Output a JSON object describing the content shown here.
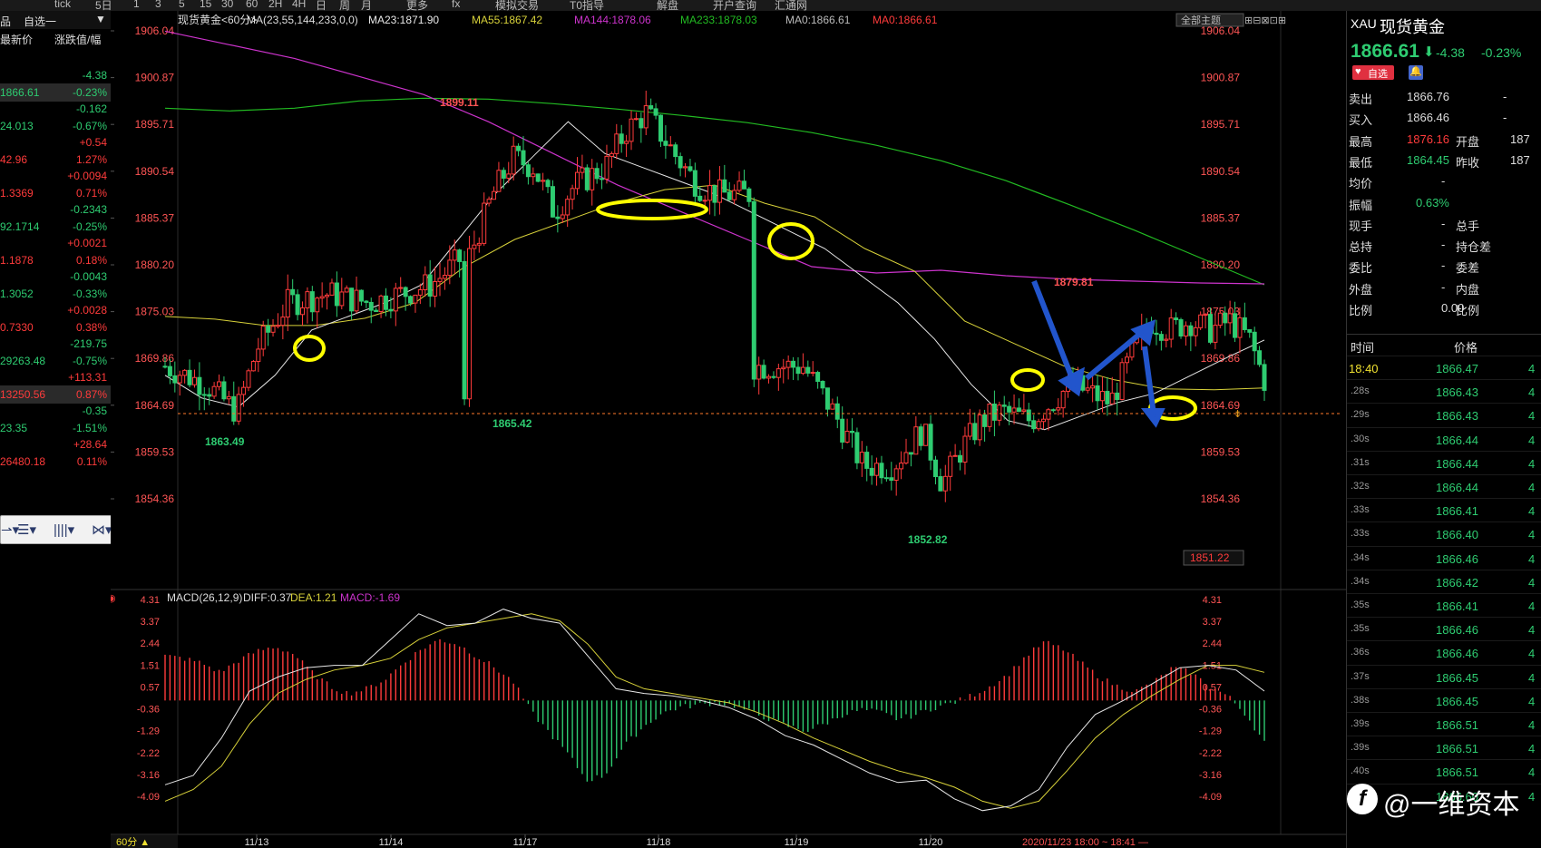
{
  "toolbar": {
    "items": [
      "tick",
      "5日",
      "1",
      "3",
      "5",
      "15",
      "30",
      "60",
      "2H",
      "4H",
      "日",
      "周",
      "月",
      "更多",
      "fx",
      "模拟交易",
      "T0指导",
      "解盘",
      "开户查询",
      "汇通网"
    ]
  },
  "watchlist": {
    "header_tab": "自选一",
    "col1": "最新价",
    "col2": "涨跌值/幅",
    "rows": [
      {
        "price": "",
        "chg": "-4.38",
        "color": "green"
      },
      {
        "price": "1866.61",
        "chg": "-0.23%",
        "color": "green"
      },
      {
        "price": "",
        "chg": "-0.162",
        "color": "green"
      },
      {
        "price": "24.013",
        "chg": "-0.67%",
        "color": "green"
      },
      {
        "price": "",
        "chg": "+0.54",
        "color": "red"
      },
      {
        "price": "42.96",
        "chg": "1.27%",
        "color": "red"
      },
      {
        "price": "",
        "chg": "+0.0094",
        "color": "red"
      },
      {
        "price": "1.3369",
        "chg": "0.71%",
        "color": "red"
      },
      {
        "price": "",
        "chg": "-0.2343",
        "color": "green"
      },
      {
        "price": "92.1714",
        "chg": "-0.25%",
        "color": "green"
      },
      {
        "price": "",
        "chg": "+0.0021",
        "color": "red"
      },
      {
        "price": "1.1878",
        "chg": "0.18%",
        "color": "red"
      },
      {
        "price": "",
        "chg": "-0.0043",
        "color": "green"
      },
      {
        "price": "1.3052",
        "chg": "-0.33%",
        "color": "green"
      },
      {
        "price": "",
        "chg": "+0.0028",
        "color": "red"
      },
      {
        "price": "0.7330",
        "chg": "0.38%",
        "color": "red"
      },
      {
        "price": "",
        "chg": "-219.75",
        "color": "green"
      },
      {
        "price": "29263.48",
        "chg": "-0.75%",
        "color": "green"
      },
      {
        "price": "",
        "chg": "+113.31",
        "color": "red"
      },
      {
        "price": "13250.56",
        "chg": "0.87%",
        "color": "red"
      },
      {
        "price": "",
        "chg": "-0.35",
        "color": "green"
      },
      {
        "price": "23.35",
        "chg": "-1.51%",
        "color": "green"
      },
      {
        "price": "",
        "chg": "+28.64",
        "color": "red"
      },
      {
        "price": "26480.18",
        "chg": "0.11%",
        "color": "red"
      }
    ]
  },
  "chart": {
    "title": "现货黄金<60分>",
    "ma_params": "MA(23,55,144,233,0,0)",
    "ma23": "MA23:1871.90",
    "ma55": "MA55:1867.42",
    "ma144": "MA144:1878.06",
    "ma233": "MA233:1878.03",
    "ma0a": "MA0:1866.61",
    "ma0b": "MA0:1866.61",
    "theme_button": "全部主题",
    "price_labels": [
      "1906.04",
      "1900.87",
      "1895.71",
      "1890.54",
      "1885.37",
      "1880.20",
      "1875.03",
      "1869.86",
      "1864.69",
      "1859.53",
      "1854.36"
    ],
    "current_tag": "1851.22",
    "annotations": {
      "high1": "1899.11",
      "low1": "1863.49",
      "low2": "1865.42",
      "low3": "1852.82",
      "high2": "1879.81"
    },
    "macd_title": "MACD(26,12,9)",
    "diff": "DIFF:0.37",
    "dea": "DEA:1.21",
    "macd": "MACD:-1.69",
    "macd_labels": [
      "4.31",
      "3.37",
      "2.44",
      "1.51",
      "0.57",
      "-0.36",
      "-1.29",
      "-2.22",
      "-3.16",
      "-4.09"
    ],
    "dates": [
      "11/13",
      "11/14",
      "11/17",
      "11/18",
      "11/19",
      "11/20"
    ],
    "period_label": "60分 ▲",
    "time_range": "2020/11/23 18:00 ~ 18:41 —",
    "colors": {
      "up": "#ff3b3b",
      "down": "#2ecc71",
      "ma23": "#e8e8e8",
      "ma55": "#d8d23a",
      "ma144": "#cc33cc",
      "ma233": "#22bb22",
      "highlight": "#ffff00",
      "arrow": "#2255cc"
    }
  },
  "chart_data": {
    "type": "candlestick",
    "title": "现货黄金<60分>",
    "x_dates": [
      "11/13",
      "11/14",
      "11/17",
      "11/18",
      "11/19",
      "11/20"
    ],
    "ylim": [
      1851.22,
      1906.04
    ],
    "last_price": 1866.61,
    "marked_highs": [
      1899.11,
      1879.81
    ],
    "marked_lows": [
      1863.49,
      1865.42,
      1852.82
    ],
    "macd": {
      "diff": 0.37,
      "dea": 1.21,
      "macd": -1.69,
      "ylim": [
        -4.09,
        4.31
      ]
    }
  },
  "quote": {
    "code": "XAU",
    "name": "现货黄金",
    "price": "1866.61",
    "change": "-4.38",
    "change_pct": "-0.23%",
    "fav_button": "自选",
    "rows": [
      {
        "l": "卖出",
        "v": "1866.76",
        "l2": "",
        "v2": "-"
      },
      {
        "l": "买入",
        "v": "1866.46",
        "l2": "",
        "v2": "-"
      },
      {
        "l": "最高",
        "v": "1876.16",
        "l2": "开盘",
        "v2": "187"
      },
      {
        "l": "最低",
        "v": "1864.45",
        "l2": "昨收",
        "v2": "187"
      },
      {
        "l": "均价",
        "v": "-",
        "l2": "",
        "v2": ""
      },
      {
        "l": "振幅",
        "v": "0.63%",
        "l2": "",
        "v2": ""
      },
      {
        "l": "现手",
        "v": "-",
        "l2": "总手",
        "v2": ""
      },
      {
        "l": "总持",
        "v": "-",
        "l2": "持仓差",
        "v2": ""
      },
      {
        "l": "委比",
        "v": "-",
        "l2": "委差",
        "v2": ""
      },
      {
        "l": "外盘",
        "v": "-",
        "l2": "内盘",
        "v2": ""
      },
      {
        "l": "比例",
        "v": "0.00",
        "l2": "比例",
        "v2": ""
      }
    ],
    "tick_header_time": "时间",
    "tick_header_price": "价格",
    "ticks": [
      {
        "t": "18:40",
        "p": "1866.47"
      },
      {
        "t": ".28s",
        "p": "1866.43"
      },
      {
        "t": ".29s",
        "p": "1866.43"
      },
      {
        "t": ".30s",
        "p": "1866.44"
      },
      {
        "t": ".31s",
        "p": "1866.44"
      },
      {
        "t": ".32s",
        "p": "1866.44"
      },
      {
        "t": ".33s",
        "p": "1866.41"
      },
      {
        "t": ".33s",
        "p": "1866.40"
      },
      {
        "t": ".34s",
        "p": "1866.46"
      },
      {
        "t": ".34s",
        "p": "1866.42"
      },
      {
        "t": ".35s",
        "p": "1866.41"
      },
      {
        "t": ".35s",
        "p": "1866.46"
      },
      {
        "t": ".36s",
        "p": "1866.46"
      },
      {
        "t": ".37s",
        "p": "1866.45"
      },
      {
        "t": ".38s",
        "p": "1866.45"
      },
      {
        "t": ".39s",
        "p": "1866.51"
      },
      {
        "t": ".39s",
        "p": "1866.51"
      },
      {
        "t": ".40s",
        "p": "1866.51"
      },
      {
        "t": ".40s",
        "p": "1866.60"
      }
    ]
  },
  "watermark": {
    "text": "@一维资本"
  }
}
